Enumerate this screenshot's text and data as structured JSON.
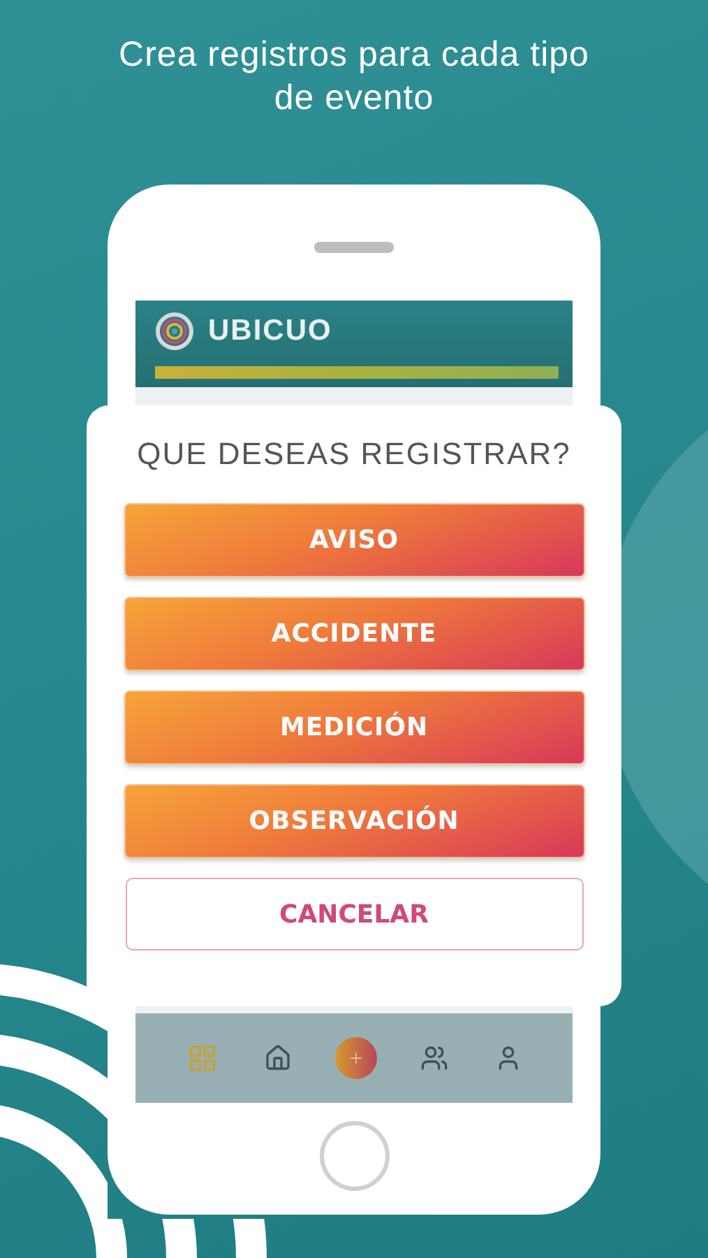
{
  "headline": "Crea registros para cada tipo de evento",
  "app": {
    "brand": "UBICUO"
  },
  "dialog": {
    "title": "QUE DESEAS REGISTRAR?",
    "options": [
      {
        "label": "AVISO"
      },
      {
        "label": "ACCIDENTE"
      },
      {
        "label": "MEDICIÓN"
      },
      {
        "label": "OBSERVACIÓN"
      }
    ],
    "cancel": "CANCELAR"
  },
  "nav": [
    {
      "kind": "grid",
      "selected": true
    },
    {
      "kind": "home",
      "selected": false
    },
    {
      "kind": "add",
      "selected": false
    },
    {
      "kind": "team",
      "selected": false
    },
    {
      "kind": "profile",
      "selected": false
    }
  ]
}
